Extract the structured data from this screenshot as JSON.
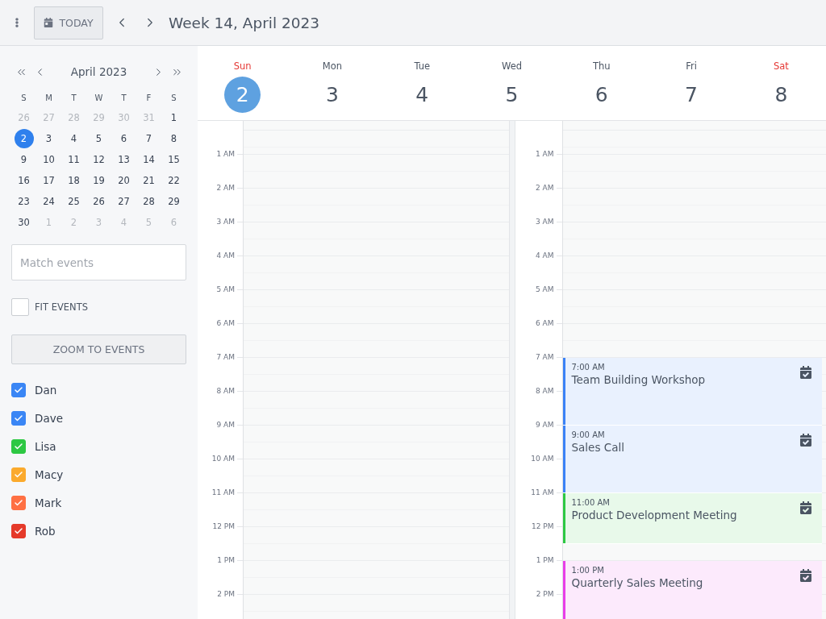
{
  "toolbar": {
    "today_button": "TODAY",
    "title": "Week 14, April 2023"
  },
  "mini_calendar": {
    "title": "April 2023",
    "weekdays": [
      "S",
      "M",
      "T",
      "W",
      "T",
      "F",
      "S"
    ],
    "days": [
      {
        "label": "26",
        "other_month": true,
        "selected": false
      },
      {
        "label": "27",
        "other_month": true,
        "selected": false
      },
      {
        "label": "28",
        "other_month": true,
        "selected": false
      },
      {
        "label": "29",
        "other_month": true,
        "selected": false
      },
      {
        "label": "30",
        "other_month": true,
        "selected": false
      },
      {
        "label": "31",
        "other_month": true,
        "selected": false
      },
      {
        "label": "1",
        "other_month": false,
        "selected": false
      },
      {
        "label": "2",
        "other_month": false,
        "selected": true
      },
      {
        "label": "3",
        "other_month": false,
        "selected": false
      },
      {
        "label": "4",
        "other_month": false,
        "selected": false
      },
      {
        "label": "5",
        "other_month": false,
        "selected": false
      },
      {
        "label": "6",
        "other_month": false,
        "selected": false
      },
      {
        "label": "7",
        "other_month": false,
        "selected": false
      },
      {
        "label": "8",
        "other_month": false,
        "selected": false
      },
      {
        "label": "9",
        "other_month": false,
        "selected": false
      },
      {
        "label": "10",
        "other_month": false,
        "selected": false
      },
      {
        "label": "11",
        "other_month": false,
        "selected": false
      },
      {
        "label": "12",
        "other_month": false,
        "selected": false
      },
      {
        "label": "13",
        "other_month": false,
        "selected": false
      },
      {
        "label": "14",
        "other_month": false,
        "selected": false
      },
      {
        "label": "15",
        "other_month": false,
        "selected": false
      },
      {
        "label": "16",
        "other_month": false,
        "selected": false
      },
      {
        "label": "17",
        "other_month": false,
        "selected": false
      },
      {
        "label": "18",
        "other_month": false,
        "selected": false
      },
      {
        "label": "19",
        "other_month": false,
        "selected": false
      },
      {
        "label": "20",
        "other_month": false,
        "selected": false
      },
      {
        "label": "21",
        "other_month": false,
        "selected": false
      },
      {
        "label": "22",
        "other_month": false,
        "selected": false
      },
      {
        "label": "23",
        "other_month": false,
        "selected": false
      },
      {
        "label": "24",
        "other_month": false,
        "selected": false
      },
      {
        "label": "25",
        "other_month": false,
        "selected": false
      },
      {
        "label": "26",
        "other_month": false,
        "selected": false
      },
      {
        "label": "27",
        "other_month": false,
        "selected": false
      },
      {
        "label": "28",
        "other_month": false,
        "selected": false
      },
      {
        "label": "29",
        "other_month": false,
        "selected": false
      },
      {
        "label": "30",
        "other_month": false,
        "selected": false
      },
      {
        "label": "1",
        "other_month": true,
        "selected": false
      },
      {
        "label": "2",
        "other_month": true,
        "selected": false
      },
      {
        "label": "3",
        "other_month": true,
        "selected": false
      },
      {
        "label": "4",
        "other_month": true,
        "selected": false
      },
      {
        "label": "5",
        "other_month": true,
        "selected": false
      },
      {
        "label": "6",
        "other_month": true,
        "selected": false
      }
    ]
  },
  "search": {
    "placeholder": "Match events"
  },
  "fit_events": {
    "label": "FIT EVENTS",
    "checked": false
  },
  "zoom_button": "ZOOM TO EVENTS",
  "resources": [
    {
      "name": "Dan",
      "checked": true,
      "color": "#3a86f5"
    },
    {
      "name": "Dave",
      "checked": true,
      "color": "#3a86f5"
    },
    {
      "name": "Lisa",
      "checked": true,
      "color": "#2dc843"
    },
    {
      "name": "Macy",
      "checked": true,
      "color": "#fbaa2d"
    },
    {
      "name": "Mark",
      "checked": true,
      "color": "#ff7043"
    },
    {
      "name": "Rob",
      "checked": true,
      "color": "#e53a2a"
    }
  ],
  "week": {
    "days": [
      {
        "name": "Sun",
        "date": "2",
        "weekend": true,
        "selected": true
      },
      {
        "name": "Mon",
        "date": "3",
        "weekend": false,
        "selected": false
      },
      {
        "name": "Tue",
        "date": "4",
        "weekend": false,
        "selected": false
      },
      {
        "name": "Wed",
        "date": "5",
        "weekend": false,
        "selected": false
      },
      {
        "name": "Thu",
        "date": "6",
        "weekend": false,
        "selected": false
      },
      {
        "name": "Fri",
        "date": "7",
        "weekend": false,
        "selected": false
      },
      {
        "name": "Sat",
        "date": "8",
        "weekend": true,
        "selected": false
      }
    ]
  },
  "time_panes": [
    {
      "hours": [
        "1 AM",
        "2 AM",
        "3 AM",
        "4 AM",
        "5 AM",
        "6 AM",
        "7 AM",
        "8 AM",
        "9 AM",
        "10 AM",
        "11 AM",
        "12 PM",
        "1 PM",
        "2 PM"
      ]
    },
    {
      "hours": [
        "1 AM",
        "2 AM",
        "3 AM",
        "4 AM",
        "5 AM",
        "6 AM",
        "7 AM",
        "8 AM",
        "9 AM",
        "10 AM",
        "11 AM",
        "12 PM",
        "1 PM",
        "2 PM"
      ],
      "events": [
        {
          "time": "7:00 AM",
          "title": "Team Building Workshop",
          "color": "#3b82f6"
        },
        {
          "time": "9:00 AM",
          "title": "Sales Call",
          "color": "#3b82f6"
        },
        {
          "time": "11:00 AM",
          "title": "Product Development Meeting",
          "color": "#2dc843"
        },
        {
          "time": "1:00 PM",
          "title": "Quarterly Sales Meeting",
          "color": "#e83ee8"
        }
      ]
    }
  ]
}
